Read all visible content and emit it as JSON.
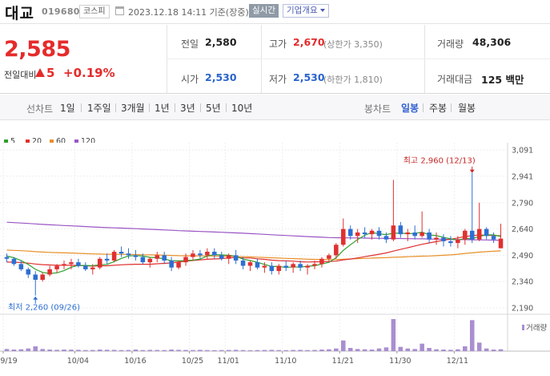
{
  "header": {
    "stock_name": "대교",
    "stock_code": "019680",
    "market": "코스피",
    "datetime": "2023.12.18 14:11 기준(장중)",
    "realtime_label": "실시간",
    "company_overview_label": "기업개요"
  },
  "price_block": {
    "current_price": "2,585",
    "compare_label": "전일대비",
    "change": "5",
    "change_pct": "+0.19%",
    "prev_close_label": "전일",
    "prev_close": "2,580",
    "high_label": "고가",
    "high": "2,670",
    "upper_limit_text": "(상한가 3,350)",
    "volume_label": "거래량",
    "volume": "48,306",
    "open_label": "시가",
    "open": "2,530",
    "low_label": "저가",
    "low": "2,530",
    "lower_limit_text": "(하한가 1,810)",
    "amount_label": "거래대금",
    "amount": "125 백만"
  },
  "toolbar": {
    "line_chart_label": "선차트",
    "periods": [
      "1일",
      "1주일",
      "3개월",
      "1년",
      "3년",
      "5년",
      "10년"
    ],
    "candle_chart_label": "봉차트",
    "candle_periods": [
      "일봉",
      "주봉",
      "월봉"
    ],
    "candle_selected": "일봉"
  },
  "legend": [
    {
      "label": "5",
      "color": "#2ca02c"
    },
    {
      "label": "20",
      "color": "#e03030"
    },
    {
      "label": "60",
      "color": "#e8902a"
    },
    {
      "label": "120",
      "color": "#9a55c4"
    }
  ],
  "colors": {
    "up": "#e03030",
    "down": "#2d6fd3",
    "volume": "#a98ed0"
  },
  "chart_data": {
    "type": "candlestick",
    "y_ticks": [
      3091,
      2941,
      2790,
      2640,
      2490,
      2340,
      2190
    ],
    "y_tick_labels": [
      "3,091",
      "2,941",
      "2,790",
      "2,640",
      "2,490",
      "2,340",
      "2,190"
    ],
    "ylim": [
      2190,
      3091
    ],
    "x_tick_labels": [
      "09/19",
      "10/04",
      "10/16",
      "10/25",
      "11/01",
      "11/10",
      "11/21",
      "11/30",
      "12/11"
    ],
    "x_tick_index": [
      0,
      10,
      18,
      26,
      31,
      39,
      47,
      55,
      63
    ],
    "high_annotation": "최고 2,960 (12/13)",
    "low_annotation": "최저 2,260 (09/26)",
    "high_index": 65,
    "low_index": 4,
    "volume_label": "거래량",
    "candles": [
      [
        2480,
        2500,
        2450,
        2470
      ],
      [
        2470,
        2480,
        2430,
        2440
      ],
      [
        2440,
        2460,
        2400,
        2410
      ],
      [
        2410,
        2420,
        2360,
        2380
      ],
      [
        2380,
        2400,
        2260,
        2350
      ],
      [
        2350,
        2390,
        2340,
        2380
      ],
      [
        2380,
        2430,
        2370,
        2410
      ],
      [
        2410,
        2440,
        2390,
        2430
      ],
      [
        2430,
        2460,
        2410,
        2440
      ],
      [
        2440,
        2470,
        2410,
        2450
      ],
      [
        2450,
        2470,
        2420,
        2430
      ],
      [
        2430,
        2450,
        2400,
        2410
      ],
      [
        2410,
        2440,
        2380,
        2420
      ],
      [
        2420,
        2480,
        2410,
        2470
      ],
      [
        2470,
        2500,
        2440,
        2460
      ],
      [
        2460,
        2520,
        2450,
        2510
      ],
      [
        2510,
        2540,
        2480,
        2500
      ],
      [
        2500,
        2530,
        2470,
        2490
      ],
      [
        2490,
        2520,
        2460,
        2480
      ],
      [
        2480,
        2500,
        2440,
        2450
      ],
      [
        2450,
        2480,
        2420,
        2470
      ],
      [
        2470,
        2510,
        2450,
        2490
      ],
      [
        2490,
        2510,
        2440,
        2460
      ],
      [
        2460,
        2480,
        2400,
        2420
      ],
      [
        2420,
        2460,
        2410,
        2450
      ],
      [
        2450,
        2500,
        2430,
        2480
      ],
      [
        2480,
        2520,
        2460,
        2500
      ],
      [
        2500,
        2520,
        2470,
        2490
      ],
      [
        2490,
        2530,
        2470,
        2510
      ],
      [
        2510,
        2530,
        2470,
        2490
      ],
      [
        2490,
        2510,
        2460,
        2470
      ],
      [
        2470,
        2500,
        2440,
        2490
      ],
      [
        2490,
        2520,
        2440,
        2460
      ],
      [
        2460,
        2480,
        2410,
        2430
      ],
      [
        2430,
        2460,
        2400,
        2450
      ],
      [
        2450,
        2470,
        2410,
        2420
      ],
      [
        2420,
        2450,
        2390,
        2430
      ],
      [
        2430,
        2450,
        2380,
        2400
      ],
      [
        2400,
        2440,
        2380,
        2430
      ],
      [
        2430,
        2460,
        2400,
        2420
      ],
      [
        2420,
        2450,
        2390,
        2440
      ],
      [
        2440,
        2460,
        2400,
        2420
      ],
      [
        2420,
        2440,
        2380,
        2430
      ],
      [
        2430,
        2460,
        2410,
        2440
      ],
      [
        2440,
        2480,
        2420,
        2470
      ],
      [
        2470,
        2500,
        2450,
        2490
      ],
      [
        2490,
        2560,
        2470,
        2550
      ],
      [
        2550,
        2700,
        2540,
        2640
      ],
      [
        2640,
        2660,
        2580,
        2600
      ],
      [
        2600,
        2640,
        2560,
        2620
      ],
      [
        2620,
        2650,
        2590,
        2610
      ],
      [
        2610,
        2640,
        2580,
        2630
      ],
      [
        2630,
        2650,
        2580,
        2600
      ],
      [
        2600,
        2620,
        2560,
        2580
      ],
      [
        2580,
        2920,
        2570,
        2660
      ],
      [
        2660,
        2680,
        2590,
        2610
      ],
      [
        2610,
        2640,
        2570,
        2620
      ],
      [
        2620,
        2660,
        2580,
        2600
      ],
      [
        2600,
        2740,
        2590,
        2620
      ],
      [
        2620,
        2640,
        2560,
        2580
      ],
      [
        2580,
        2620,
        2550,
        2590
      ],
      [
        2590,
        2610,
        2540,
        2570
      ],
      [
        2570,
        2600,
        2540,
        2560
      ],
      [
        2560,
        2600,
        2530,
        2580
      ],
      [
        2580,
        2640,
        2550,
        2630
      ],
      [
        2630,
        2960,
        2560,
        2580
      ],
      [
        2580,
        2790,
        2570,
        2640
      ],
      [
        2640,
        2650,
        2580,
        2600
      ],
      [
        2600,
        2620,
        2560,
        2580
      ],
      [
        2530,
        2670,
        2530,
        2585
      ]
    ],
    "volumes": [
      4000,
      3000,
      3500,
      5000,
      9000,
      4000,
      3000,
      2500,
      3000,
      2800,
      2500,
      2000,
      2200,
      3000,
      2600,
      2400,
      2000,
      2200,
      3000,
      2000,
      2400,
      2200,
      2000,
      3000,
      2500,
      2200,
      2000,
      2500,
      2000,
      1800,
      2000,
      2200,
      2500,
      2000,
      1800,
      2000,
      2200,
      2400,
      2000,
      1800,
      2200,
      2400,
      2000,
      2200,
      3000,
      3500,
      5000,
      20000,
      6000,
      4000,
      3500,
      3000,
      5000,
      7000,
      60000,
      8000,
      5000,
      4000,
      14000,
      6000,
      3500,
      3000,
      2500,
      3500,
      9000,
      58000,
      16000,
      5000,
      3000,
      3500
    ]
  }
}
